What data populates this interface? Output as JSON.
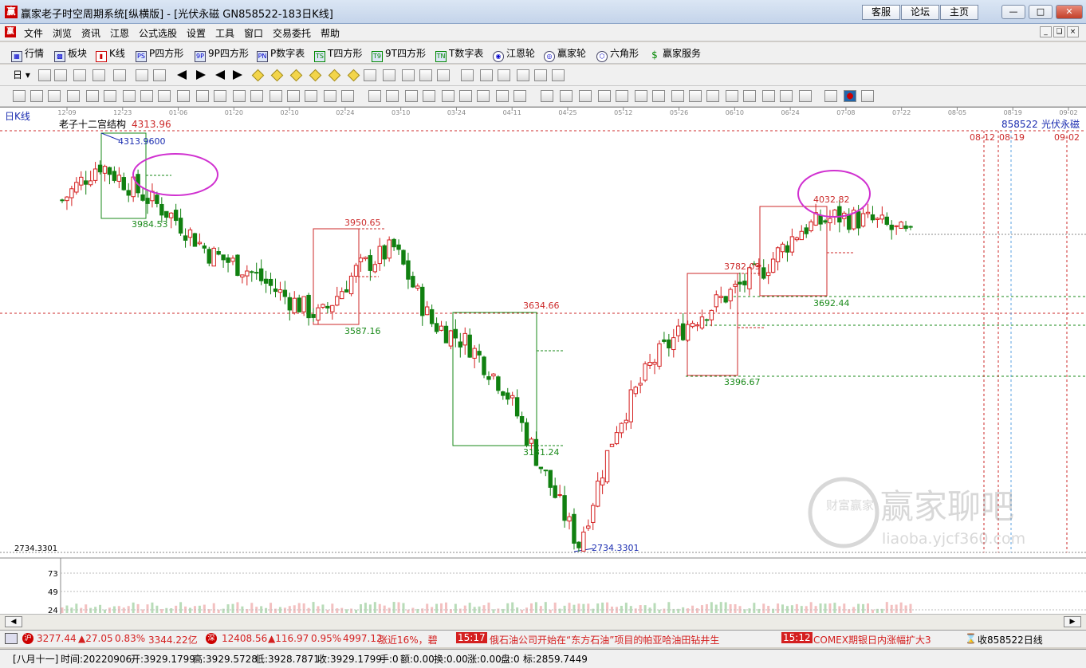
{
  "window": {
    "title": "赢家老子时空周期系统[纵横版] - [光伏永磁  GN858522-183日K线]",
    "top_buttons": [
      "客服",
      "论坛",
      "主页"
    ],
    "min_icon": "minimize-icon",
    "max_icon": "maximize-icon",
    "close_icon": "close-icon"
  },
  "menu": [
    "文件",
    "浏览",
    "资讯",
    "江恩",
    "公式选股",
    "设置",
    "工具",
    "窗口",
    "交易委托",
    "帮助"
  ],
  "toolbar1": [
    {
      "label": "行情",
      "icon": "grid-icon"
    },
    {
      "label": "板块",
      "icon": "blocks-icon"
    },
    {
      "label": "K线",
      "icon": "kline-icon"
    },
    {
      "label": "P四方形",
      "icon": "ps"
    },
    {
      "label": "9P四方形",
      "icon": "9p"
    },
    {
      "label": "P数字表",
      "icon": "pn"
    },
    {
      "label": "T四方形",
      "icon": "ts"
    },
    {
      "label": "9T四方形",
      "icon": "9t"
    },
    {
      "label": "T数字表",
      "icon": "tn"
    },
    {
      "label": "江恩轮",
      "icon": "wheel-icon"
    },
    {
      "label": "赢家轮",
      "icon": "yj-wheel-icon"
    },
    {
      "label": "六角形",
      "icon": "hexagon-icon"
    },
    {
      "label": "赢家服务",
      "icon": "dollar-icon"
    }
  ],
  "toolbar2_period": "日",
  "chart": {
    "panel_label": "日K线",
    "indicator_title": "老子十二宫结构",
    "top_value": "4313.96",
    "stock_code": "858522",
    "stock_name": "光伏永磁",
    "future_dates": [
      "08-12",
      "08-19",
      "09-02"
    ],
    "x_axis_dates": [
      "12-09",
      "12-23",
      "01-06",
      "01-20",
      "02-10",
      "02-24",
      "03-10",
      "03-24",
      "04-11",
      "04-25",
      "05-12",
      "05-26",
      "06-10",
      "06-24",
      "07-08",
      "07-22",
      "08-05",
      "08-19",
      "09-02"
    ],
    "y_axis_low_label": "2734.3301",
    "volume_ticks": [
      "73",
      "49",
      "24"
    ],
    "annotations": {
      "high_point": "4313.9600",
      "low_point": "2734.3301",
      "box1_low": "3984.53",
      "box2_high": "3950.65",
      "box2_low": "3587.16",
      "box3_high": "3634.66",
      "box3_low": "3131.24",
      "box4_high": "3782.09",
      "box4_low": "3396.67",
      "box5_high": "4032.82",
      "box5_low": "3692.44"
    },
    "watermark": {
      "title": "赢家聊吧",
      "url": "liaoba.yjcf360.com",
      "logo_text": "财富赢家"
    },
    "colors": {
      "up": "#d42020",
      "down": "#108010",
      "box_red": "#cc2a2a",
      "box_green": "#1a8a1a",
      "circle": "#d030d0",
      "blue_label": "#1a2cb0"
    }
  },
  "chart_data": {
    "type": "candlestick",
    "title": "老子十二宫结构",
    "dates": [
      "12-09",
      "12-23",
      "01-06",
      "01-20",
      "02-10",
      "02-24",
      "03-10",
      "03-24",
      "04-11",
      "04-25",
      "05-12",
      "05-26",
      "06-10",
      "06-24",
      "07-08",
      "07-22"
    ],
    "close_path": [
      4060,
      4200,
      4100,
      4000,
      3860,
      3800,
      3700,
      3620,
      3800,
      3880,
      3600,
      3520,
      3350,
      3050,
      2760,
      3200,
      3450,
      3600,
      3700,
      3800,
      3950,
      4000,
      3980,
      3920
    ],
    "ylim": [
      2734.3301,
      4313.96
    ],
    "marked_levels": [
      4313.96,
      3984.53,
      3950.65,
      3587.16,
      3634.66,
      3131.24,
      3782.09,
      3396.67,
      4032.82,
      3692.44,
      2734.3301
    ],
    "volume_ticks": [
      73,
      49,
      24
    ]
  },
  "status_bar": {
    "index1_value": "3277.44",
    "index1_change": "▲27.05",
    "index1_pct": "0.83%",
    "index1_amount": "3344.22亿",
    "index2_value": "12408.56",
    "index2_change": "▲116.97",
    "index2_pct": "0.95%",
    "index2_amount": "4997.12",
    "news_fragment": "涨近16%，碧",
    "news1_time": "15:17",
    "news1_text": "俄石油公司开始在“东方石油”项目的帕亚哈油田钻井生",
    "news2_time": "15:12",
    "news2_text": "COMEX期银日内涨幅扩大3",
    "close_label": "收858522日线"
  },
  "info_bar": {
    "lunar": "[八月十一]",
    "time": "时间:20220906",
    "open": "开:3929.1799",
    "high": "高:3929.5728",
    "low": "低:3928.7871",
    "close": "收:3929.1799",
    "hand": "手:0",
    "amount": "额:0.00",
    "turnover": "换:0.00",
    "change": "涨:0.00",
    "pan": "盘:0",
    "mark": "标:2859.7449"
  }
}
